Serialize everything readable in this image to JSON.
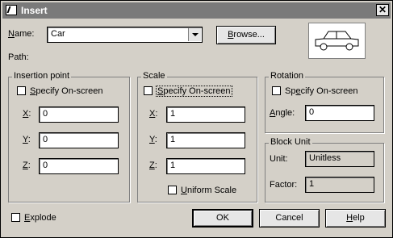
{
  "window": {
    "title": "Insert",
    "close_glyph": "✕"
  },
  "name_field": {
    "label": "Name:",
    "value": "Car",
    "browse_label": "Browse..."
  },
  "path": {
    "label": "Path:"
  },
  "insertion_point": {
    "title": "Insertion point",
    "specify_label": "Specify On-screen",
    "x_label": "X:",
    "x_value": "0",
    "y_label": "Y:",
    "y_value": "0",
    "z_label": "Z:",
    "z_value": "0"
  },
  "scale": {
    "title": "Scale",
    "specify_label": "Specify On-screen",
    "x_label": "X:",
    "x_value": "1",
    "y_label": "Y:",
    "y_value": "1",
    "z_label": "Z:",
    "z_value": "1",
    "uniform_label": "Uniform Scale"
  },
  "rotation": {
    "title": "Rotation",
    "specify_label": "Specify On-screen",
    "angle_label": "Angle:",
    "angle_value": "0"
  },
  "block_unit": {
    "title": "Block Unit",
    "unit_label": "Unit:",
    "unit_value": "Unitless",
    "factor_label": "Factor:",
    "factor_value": "1"
  },
  "explode": {
    "label": "Explode"
  },
  "buttons": {
    "ok": "OK",
    "cancel": "Cancel",
    "help": "Help"
  },
  "icons": {
    "preview": "car-preview-icon"
  }
}
